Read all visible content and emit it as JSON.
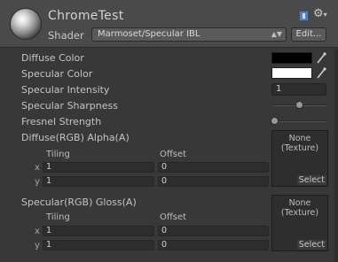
{
  "header": {
    "material_name": "ChromeTest",
    "shader_label": "Shader",
    "shader_value": "Marmoset/Specular IBL",
    "edit_label": "Edit...",
    "icons": [
      "material-sphere-icon",
      "help-book-icon",
      "gear-icon"
    ]
  },
  "properties": {
    "diffuse_color": {
      "label": "Diffuse Color",
      "color": "#000000"
    },
    "specular_color": {
      "label": "Specular Color",
      "color": "#ffffff"
    },
    "specular_intensity": {
      "label": "Specular Intensity",
      "value": "1"
    },
    "specular_sharpness": {
      "label": "Specular Sharpness",
      "slider": 0.5
    },
    "fresnel_strength": {
      "label": "Fresnel Strength",
      "slider": 0.0
    }
  },
  "textures": [
    {
      "label": "Diffuse(RGB) Alpha(A)",
      "none_line1": "None",
      "none_line2": "(Texture)",
      "select_label": "Select",
      "tiling_label": "Tiling",
      "offset_label": "Offset",
      "x_label": "x",
      "y_label": "y",
      "tiling_x": "1",
      "tiling_y": "1",
      "offset_x": "0",
      "offset_y": "0"
    },
    {
      "label": "Specular(RGB) Gloss(A)",
      "none_line1": "None",
      "none_line2": "(Texture)",
      "select_label": "Select",
      "tiling_label": "Tiling",
      "offset_label": "Offset",
      "x_label": "x",
      "y_label": "y",
      "tiling_x": "1",
      "tiling_y": "1",
      "offset_x": "0",
      "offset_y": "0"
    }
  ]
}
